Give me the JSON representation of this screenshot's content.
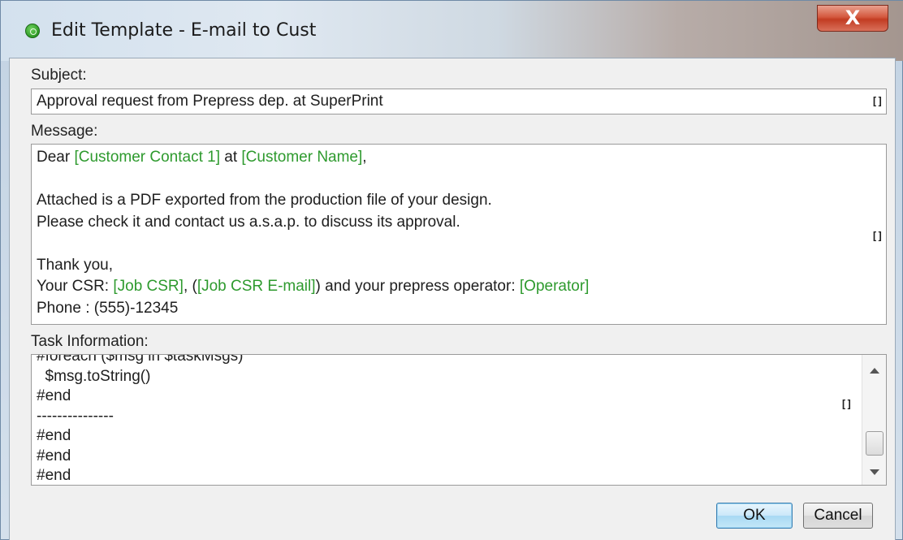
{
  "window": {
    "title": "Edit Template - E-mail to Cust",
    "close_glyph": "X",
    "icon": "green-settings-icon",
    "accent_color": "#2e9a2e"
  },
  "subject": {
    "label": "Subject:",
    "value": "Approval request from Prepress dep. at SuperPrint",
    "expand_glyph": "[]"
  },
  "message": {
    "label": "Message:",
    "expand_glyph": "[]",
    "lines": [
      [
        {
          "t": "Dear ",
          "v": false
        },
        {
          "t": "[Customer Contact 1]",
          "v": true
        },
        {
          "t": " at ",
          "v": false
        },
        {
          "t": "[Customer Name]",
          "v": true
        },
        {
          "t": ",",
          "v": false
        }
      ],
      [],
      [
        {
          "t": "Attached is a PDF exported from the production file of your design.",
          "v": false
        }
      ],
      [
        {
          "t": "Please check it and contact us a.s.a.p. to discuss its approval.",
          "v": false
        }
      ],
      [],
      [
        {
          "t": "Thank you,",
          "v": false
        }
      ],
      [
        {
          "t": "Your CSR: ",
          "v": false
        },
        {
          "t": "[Job CSR]",
          "v": true
        },
        {
          "t": ", (",
          "v": false
        },
        {
          "t": "[Job CSR E-mail]",
          "v": true
        },
        {
          "t": ") and your prepress operator: ",
          "v": false
        },
        {
          "t": "[Operator]",
          "v": true
        }
      ],
      [
        {
          "t": "Phone : (555)-12345",
          "v": false
        }
      ]
    ]
  },
  "task_info": {
    "label": "Task Information:",
    "expand_glyph": "[]",
    "lines": [
      "#foreach ($msg in $taskMsgs)",
      "  $msg.toString()",
      "#end",
      "---------------",
      "#end",
      "#end",
      "#end"
    ]
  },
  "buttons": {
    "ok": "OK",
    "cancel": "Cancel"
  }
}
